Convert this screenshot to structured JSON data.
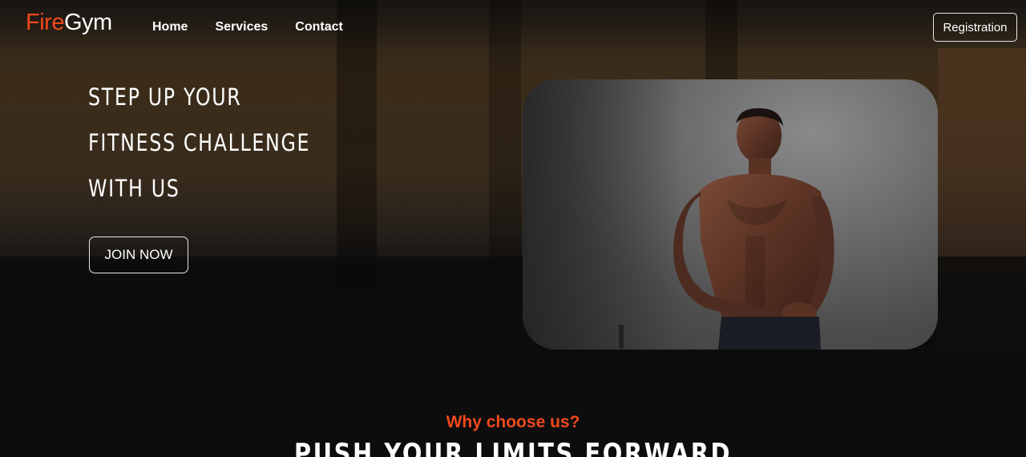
{
  "brand": {
    "fire": "Fire",
    "gym": "Gym",
    "accent_color": "#f0491c"
  },
  "nav": {
    "links": [
      {
        "label": "Home"
      },
      {
        "label": "Services"
      },
      {
        "label": "Contact"
      }
    ],
    "registration_label": "Registration"
  },
  "hero": {
    "headline_lines": [
      "STEP UP YOUR",
      "FITNESS CHALLENGE",
      "WITH US"
    ],
    "cta_label": "JOIN NOW",
    "image_alt": "muscular man photo"
  },
  "why": {
    "label": "Why choose us?",
    "heading": "PUSH YOUR LIMITS FORWARD"
  }
}
